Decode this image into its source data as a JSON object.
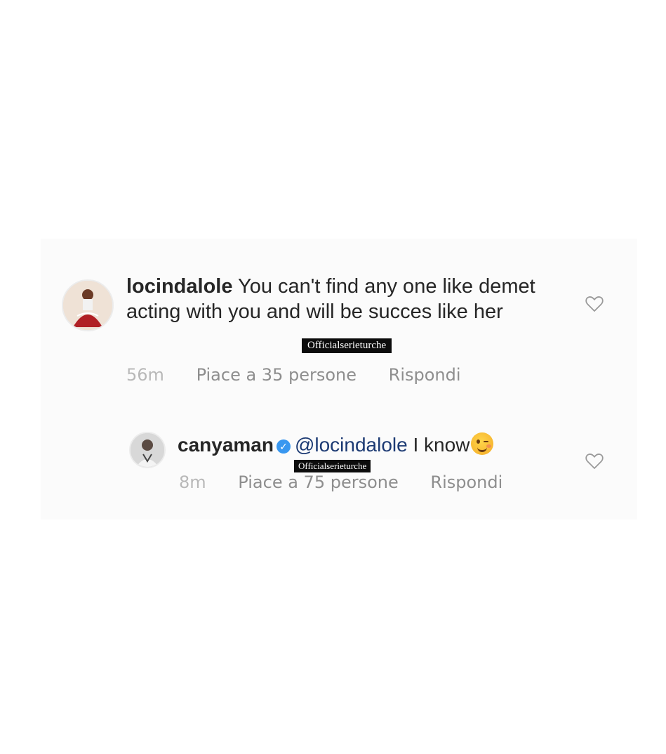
{
  "comment1": {
    "username": "locindalole",
    "text": "You can't find any one like demet acting with you and will be succes like her",
    "time": "56m",
    "likes": "Piace a 35 persone",
    "reply": "Rispondi",
    "watermark": "Officialserieturche"
  },
  "comment2": {
    "username": "canyaman",
    "verified_glyph": "✓",
    "mention": "@locindalole",
    "text": "I know",
    "emoji": "winking-face",
    "time": "8m",
    "likes": "Piace a 75 persone",
    "reply": "Rispondi",
    "watermark": "Officialserieturche"
  },
  "colors": {
    "username": "#262626",
    "meta": "#8e8e8e",
    "mention": "#1c3a73",
    "verified": "#3897f0"
  }
}
